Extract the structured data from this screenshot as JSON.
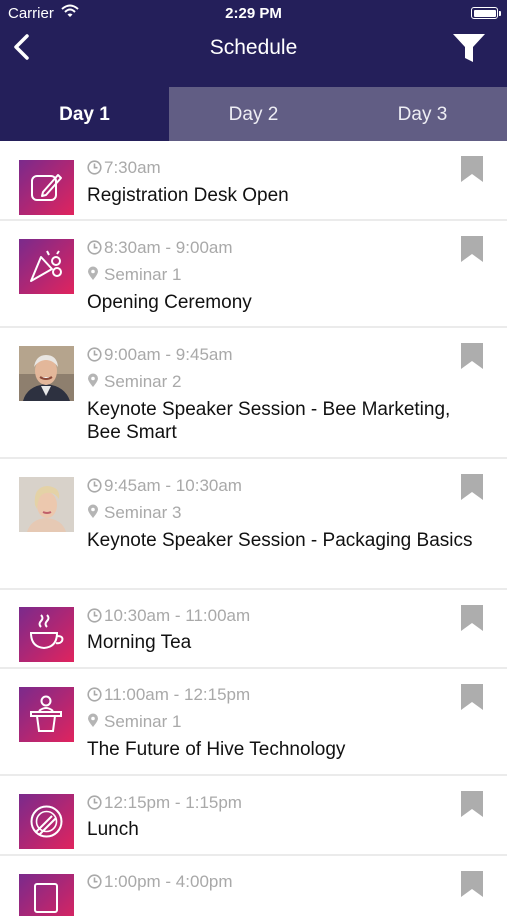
{
  "status_bar": {
    "carrier": "Carrier",
    "time": "2:29 PM"
  },
  "nav": {
    "title": "Schedule"
  },
  "tabs": [
    {
      "label": "Day 1",
      "active": true
    },
    {
      "label": "Day 2",
      "active": false
    },
    {
      "label": "Day 3",
      "active": false
    }
  ],
  "colors": {
    "header": "#241f5a",
    "tab_bar": "#615d84",
    "icon_gradient": [
      "#7a2a8c",
      "#e0245e"
    ],
    "meta_text": "#a9a9a9",
    "bookmark": "#adadad"
  },
  "events": [
    {
      "time": "7:30am",
      "location": "",
      "title": "Registration Desk Open",
      "icon": "edit-icon"
    },
    {
      "time": "8:30am - 9:00am",
      "location": "Seminar 1",
      "title": "Opening Ceremony",
      "icon": "celebration-icon"
    },
    {
      "time": "9:00am - 9:45am",
      "location": "Seminar 2",
      "title": "Keynote Speaker Session - Bee Marketing, Bee Smart",
      "icon": "speaker-photo-man"
    },
    {
      "time": "9:45am - 10:30am",
      "location": "Seminar 3",
      "title": "Keynote Speaker Session - Packaging Basics",
      "icon": "speaker-photo-woman"
    },
    {
      "time": "10:30am - 11:00am",
      "location": "",
      "title": "Morning Tea",
      "icon": "teacup-icon"
    },
    {
      "time": "11:00am - 12:15pm",
      "location": "Seminar 1",
      "title": "The Future of Hive Technology",
      "icon": "podium-icon"
    },
    {
      "time": "12:15pm - 1:15pm",
      "location": "",
      "title": "Lunch",
      "icon": "plate-icon"
    },
    {
      "time": "1:00pm - 4:00pm",
      "location": "",
      "title": "",
      "icon": "document-icon"
    }
  ]
}
